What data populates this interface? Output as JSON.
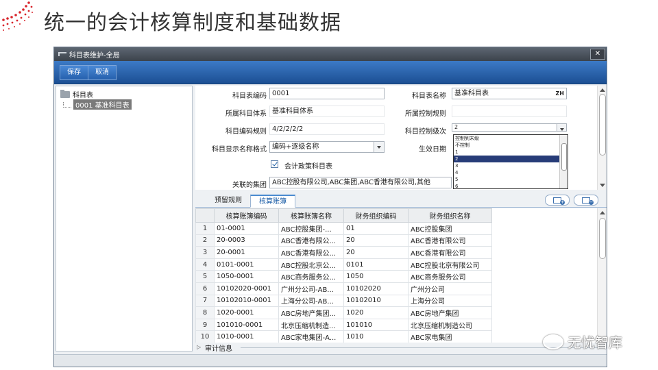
{
  "slide": {
    "title": "统一的会计核算制度和基础数据"
  },
  "window": {
    "title": "科目表维护-全局",
    "close_label": "✕"
  },
  "toolbar": {
    "save_label": "保存",
    "cancel_label": "取消"
  },
  "tree": {
    "root_label": "科目表",
    "child_label": "0001 基准科目表"
  },
  "form": {
    "code_label": "科目表编码",
    "code_value": "0001",
    "name_label": "科目表名称",
    "name_value": "基准科目表",
    "name_lang": "ZH",
    "system_label": "所属科目体系",
    "system_value": "基准科目体系",
    "control_rule_label": "所属控制规则",
    "control_rule_value": "",
    "coding_rule_label": "科目编码规则",
    "coding_rule_value": "4/2/2/2/2",
    "control_level_label": "科目控制级次",
    "control_level_value": "2",
    "display_label": "科目显示名称格式",
    "display_value": "编码+逐级名称",
    "effective_label": "生效日期",
    "policy_checkbox_label": "会计政策科目表",
    "group_label": "关联的集团",
    "group_value": "ABC控股有限公司,ABC集团,ABC香港有限公司,其他"
  },
  "dropdown": {
    "options": [
      "控制到末级",
      "不控制",
      "1",
      "2",
      "3",
      "4",
      "5",
      "6"
    ],
    "selected_index": 3
  },
  "tabs": [
    {
      "label": "预留规则"
    },
    {
      "label": "核算账簿"
    }
  ],
  "grid": {
    "columns": [
      "核算账簿编码",
      "核算账簿名称",
      "财务组织编码",
      "财务组织名称"
    ],
    "rows": [
      [
        "1",
        "01-0001",
        "ABC控股集团-...",
        "01",
        "ABC控股集团"
      ],
      [
        "2",
        "20-0003",
        "ABC香港有限公...",
        "20",
        "ABC香港有限公司"
      ],
      [
        "3",
        "20-0001",
        "ABC香港有限公...",
        "20",
        "ABC香港有限公司"
      ],
      [
        "4",
        "0101-0001",
        "ABC控股北京公...",
        "0101",
        "ABC控股北京有限公司"
      ],
      [
        "5",
        "1050-0001",
        "ABC商务服务公...",
        "1050",
        "ABC商务服务公司"
      ],
      [
        "6",
        "10102020-0001",
        "广州分公司-AB...",
        "10102020",
        "广州分公司"
      ],
      [
        "7",
        "10102010-0001",
        "上海分公司-AB...",
        "10102010",
        "上海分公司"
      ],
      [
        "8",
        "1020-0001",
        "ABC房地产集团...",
        "1020",
        "ABC房地产集团"
      ],
      [
        "9",
        "101010-0001",
        "北京压缩机制造...",
        "101010",
        "北京压缩机制造公司"
      ],
      [
        "10",
        "1010-0001",
        "ABC家电集团-A...",
        "1010",
        "ABC家电集团"
      ]
    ]
  },
  "audit": {
    "label": "审计信息"
  },
  "watermark": {
    "text": "无忧智库"
  }
}
